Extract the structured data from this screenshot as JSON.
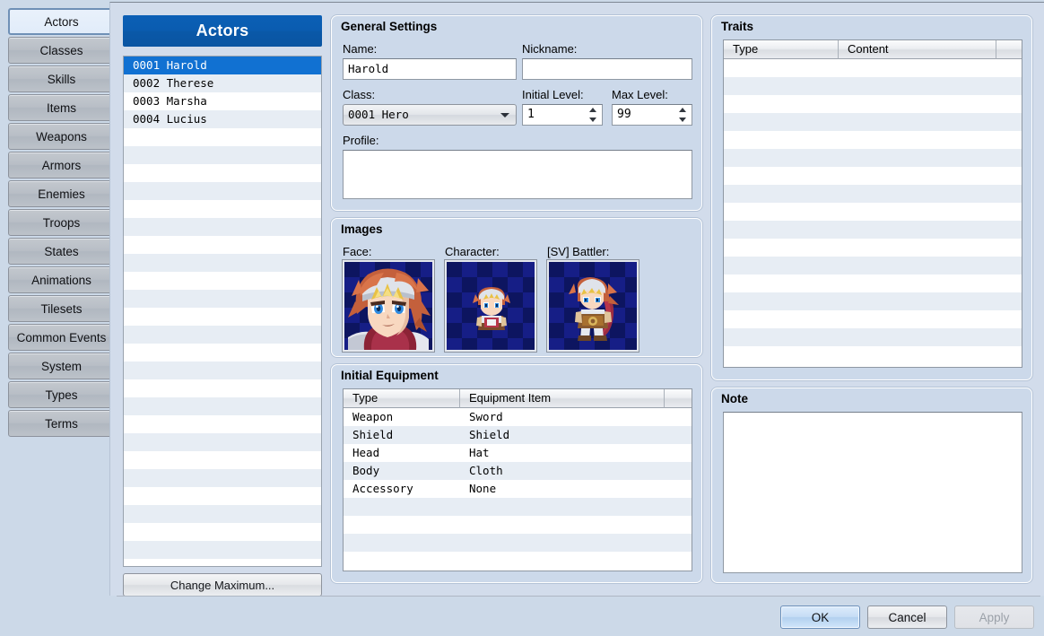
{
  "window": {
    "tabs": [
      {
        "label": "Actors",
        "selected": true
      },
      {
        "label": "Classes",
        "selected": false
      },
      {
        "label": "Skills",
        "selected": false
      },
      {
        "label": "Items",
        "selected": false
      },
      {
        "label": "Weapons",
        "selected": false
      },
      {
        "label": "Armors",
        "selected": false
      },
      {
        "label": "Enemies",
        "selected": false
      },
      {
        "label": "Troops",
        "selected": false
      },
      {
        "label": "States",
        "selected": false
      },
      {
        "label": "Animations",
        "selected": false
      },
      {
        "label": "Tilesets",
        "selected": false
      },
      {
        "label": "Common Events",
        "selected": false
      },
      {
        "label": "System",
        "selected": false
      },
      {
        "label": "Types",
        "selected": false
      },
      {
        "label": "Terms",
        "selected": false
      }
    ]
  },
  "list": {
    "title": "Actors",
    "items": [
      {
        "label": "0001 Harold",
        "selected": true
      },
      {
        "label": "0002 Therese",
        "selected": false
      },
      {
        "label": "0003 Marsha",
        "selected": false
      },
      {
        "label": "0004 Lucius",
        "selected": false
      }
    ],
    "change_maximum_label": "Change Maximum..."
  },
  "general": {
    "title": "General Settings",
    "name_label": "Name:",
    "name_value": "Harold",
    "nickname_label": "Nickname:",
    "nickname_value": "",
    "class_label": "Class:",
    "class_value": "0001 Hero",
    "initial_level_label": "Initial Level:",
    "initial_level_value": "1",
    "max_level_label": "Max Level:",
    "max_level_value": "99",
    "profile_label": "Profile:",
    "profile_value": ""
  },
  "images": {
    "title": "Images",
    "face_label": "Face:",
    "character_label": "Character:",
    "battler_label": "[SV] Battler:"
  },
  "equipment": {
    "title": "Initial Equipment",
    "columns": [
      "Type",
      "Equipment Item",
      ""
    ],
    "rows": [
      [
        "Weapon",
        "Sword"
      ],
      [
        "Shield",
        "Shield"
      ],
      [
        "Head",
        "Hat"
      ],
      [
        "Body",
        "Cloth"
      ],
      [
        "Accessory",
        "None"
      ]
    ]
  },
  "traits": {
    "title": "Traits",
    "columns": [
      "Type",
      "Content",
      ""
    ],
    "rows": []
  },
  "note": {
    "title": "Note",
    "value": ""
  },
  "buttons": {
    "ok": "OK",
    "cancel": "Cancel",
    "apply": "Apply"
  },
  "colors": {
    "accent": "#0a58a8",
    "selection": "#1171d2",
    "panel": "#ccd9ea",
    "window": "#d2dceb"
  }
}
